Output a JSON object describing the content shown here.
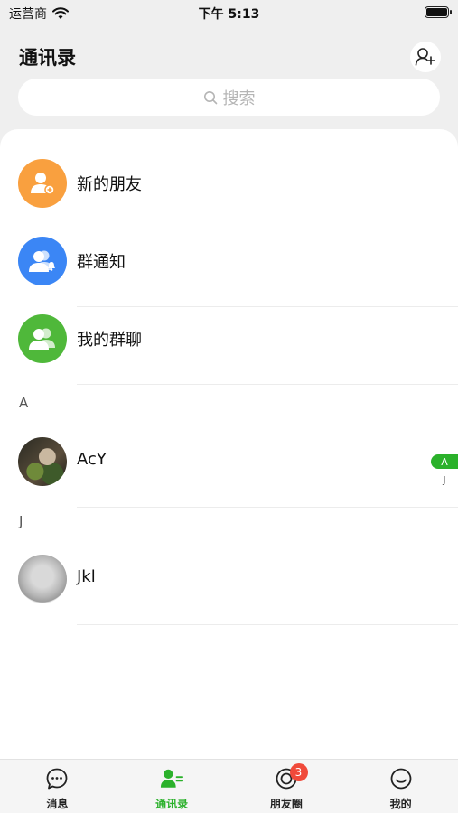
{
  "status_bar": {
    "carrier": "运营商",
    "time": "下午 5:13"
  },
  "header": {
    "title": "通讯录"
  },
  "search": {
    "placeholder": "搜索"
  },
  "shortcuts": [
    {
      "label": "新的朋友",
      "color": "#f9a03f",
      "icon": "add-person-icon"
    },
    {
      "label": "群通知",
      "color": "#3b86f5",
      "icon": "group-notification-icon"
    },
    {
      "label": "我的群聊",
      "color": "#4fb83a",
      "icon": "group-chat-icon"
    }
  ],
  "sections": [
    {
      "letter": "A",
      "contacts": [
        {
          "name": "AcY"
        }
      ]
    },
    {
      "letter": "J",
      "contacts": [
        {
          "name": "Jkl"
        }
      ]
    }
  ],
  "index_bar": {
    "items": [
      "A",
      "J"
    ],
    "active": "A",
    "active_color": "#2bb12b"
  },
  "tabbar": {
    "tabs": [
      {
        "label": "消息",
        "icon": "chat-bubble-icon"
      },
      {
        "label": "通讯录",
        "icon": "contacts-icon",
        "active": true
      },
      {
        "label": "朋友圈",
        "icon": "moments-icon",
        "badge": "3"
      },
      {
        "label": "我的",
        "icon": "smiley-icon"
      }
    ]
  },
  "colors": {
    "accent": "#2bb12b",
    "badge": "#f04a3a"
  }
}
